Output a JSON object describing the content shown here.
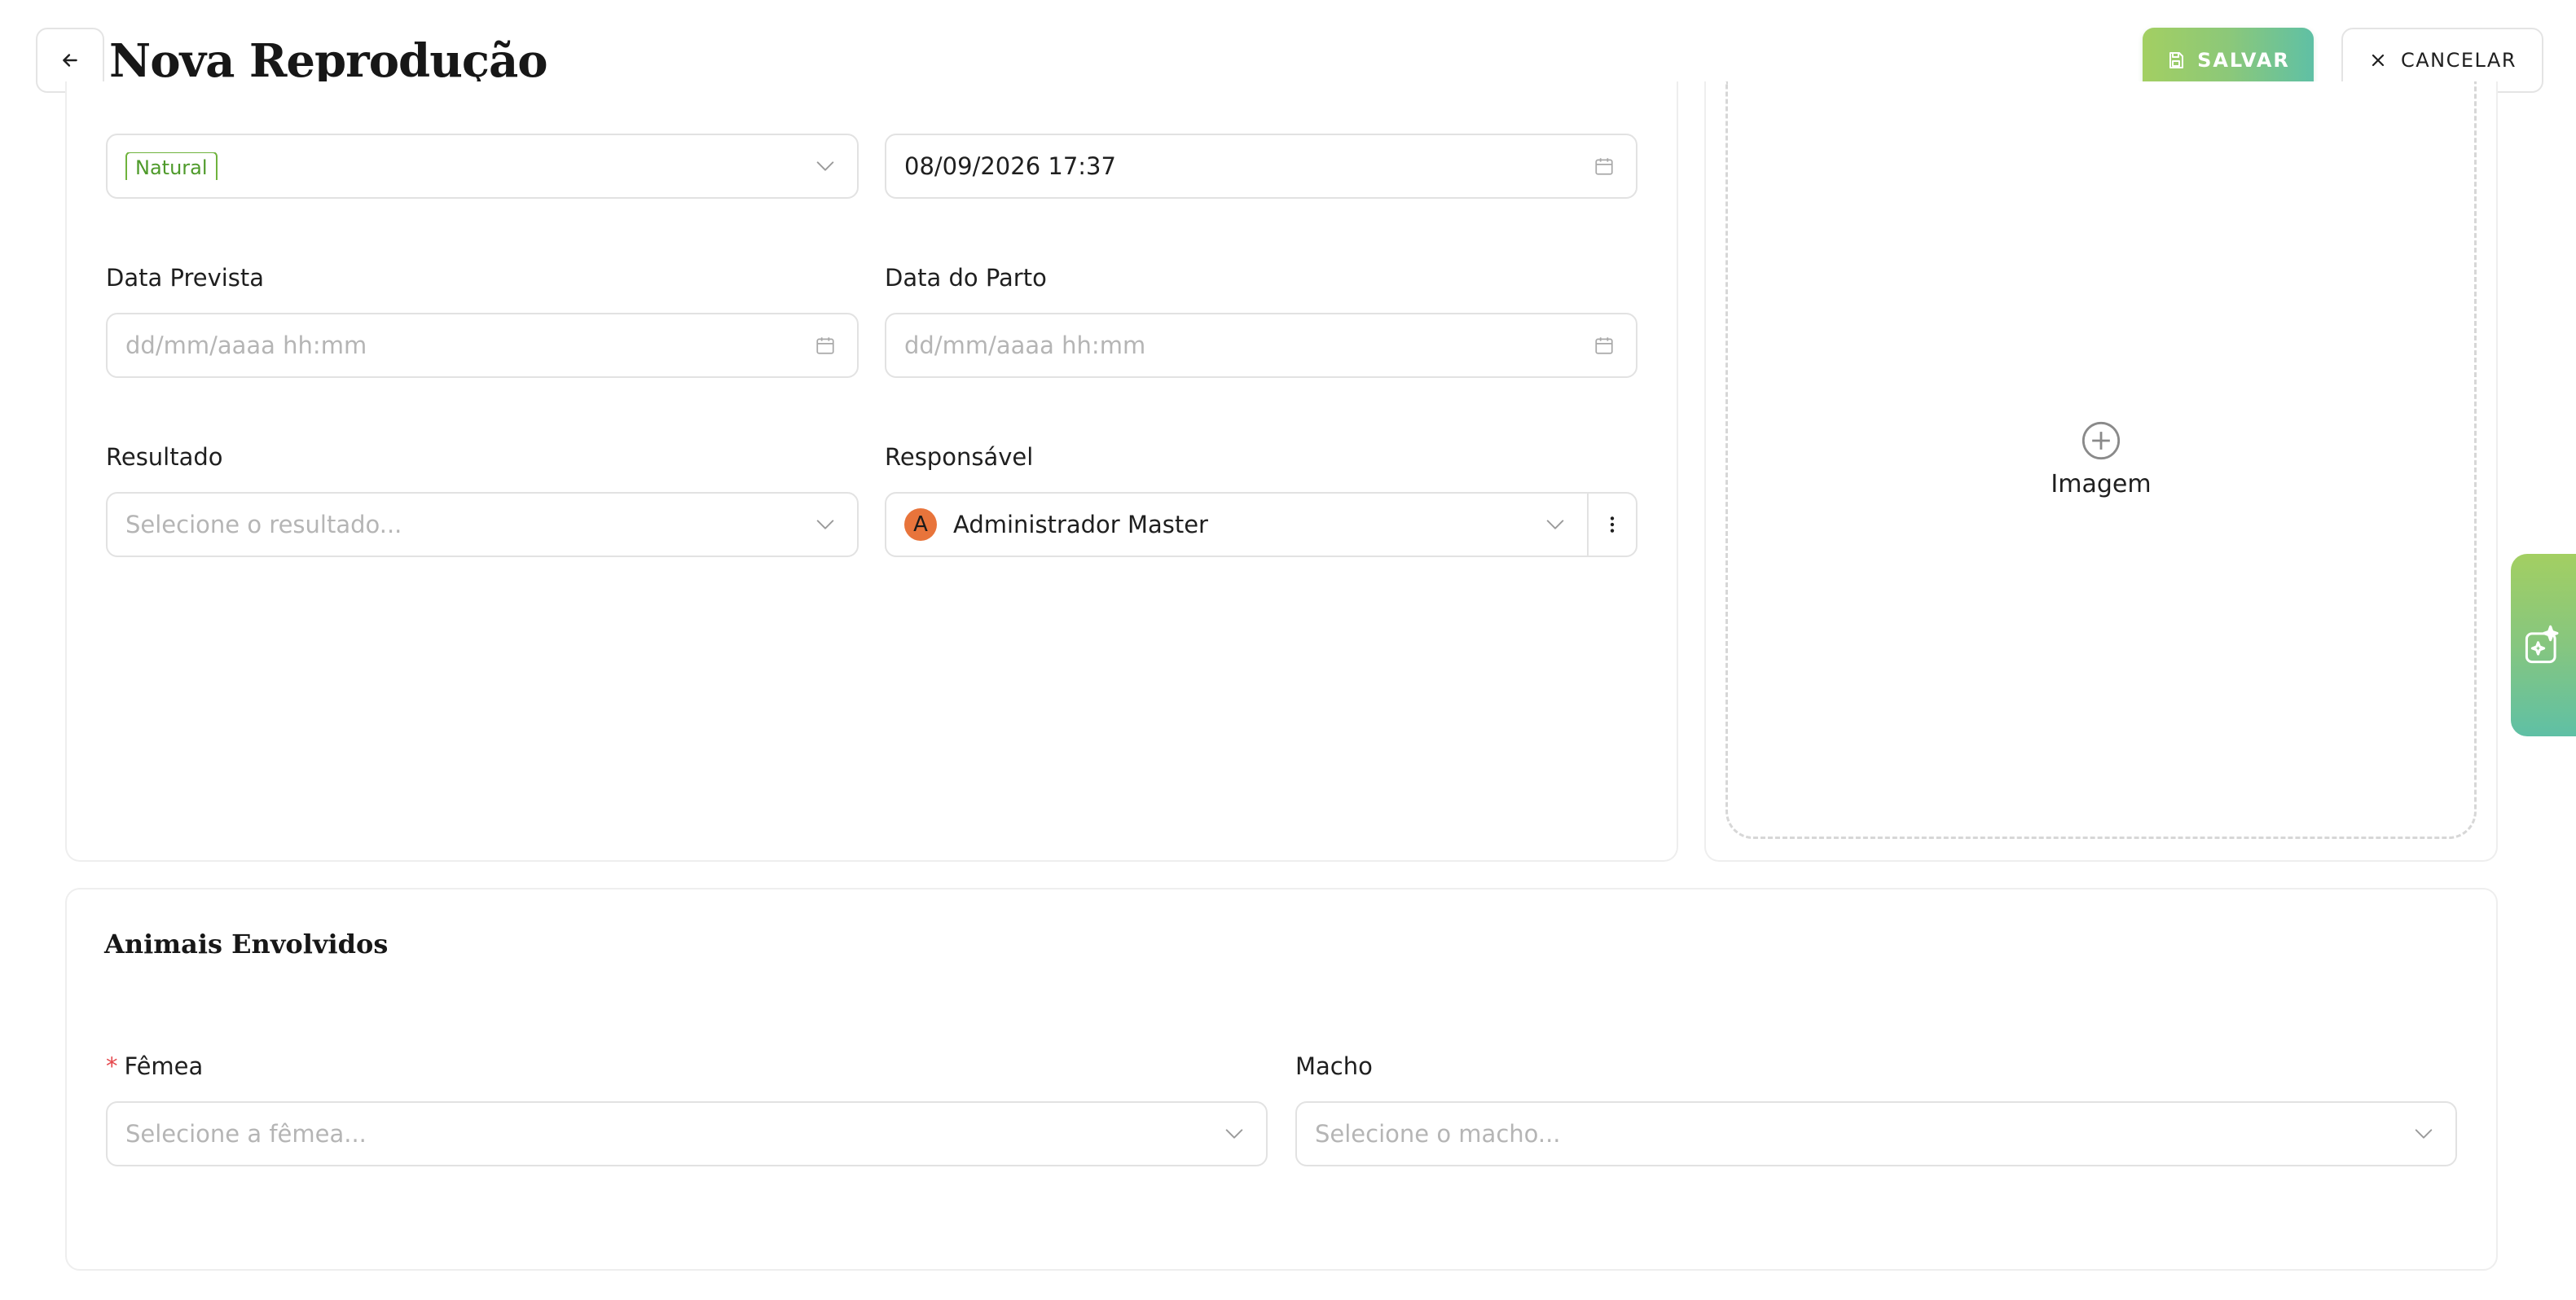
{
  "header": {
    "title": "Nova Reprodução",
    "save_label": "SALVAR",
    "cancel_label": "CANCELAR"
  },
  "form": {
    "tipo": {
      "tag": "Natural"
    },
    "data": {
      "value": "08/09/2026 17:37"
    },
    "data_prevista": {
      "label": "Data Prevista",
      "placeholder": "dd/mm/aaaa hh:mm"
    },
    "data_parto": {
      "label": "Data do Parto",
      "placeholder": "dd/mm/aaaa hh:mm"
    },
    "resultado": {
      "label": "Resultado",
      "placeholder": "Selecione o resultado..."
    },
    "responsavel": {
      "label": "Responsável",
      "value": "Administrador Master",
      "avatar_initial": "A"
    }
  },
  "image": {
    "label": "Imagem"
  },
  "animals": {
    "title": "Animais Envolvidos",
    "femea": {
      "required_mark": "*",
      "label": "Fêmea",
      "placeholder": "Selecione a fêmea..."
    },
    "macho": {
      "label": "Macho",
      "placeholder": "Selecione o macho..."
    }
  },
  "colors": {
    "accent_start": "#a3cf62",
    "accent_end": "#5fc0a5",
    "tag_green": "#4e9a2a",
    "avatar_orange": "#e8743b",
    "required_red": "#e5484d"
  },
  "icons": {
    "back": "arrow-left-icon",
    "save": "save-icon",
    "cancel": "close-icon",
    "calendar": "calendar-icon",
    "chevron": "chevron-down-icon",
    "more": "more-vertical-icon",
    "add": "plus-circle-icon",
    "ai": "sparkle-icon"
  }
}
